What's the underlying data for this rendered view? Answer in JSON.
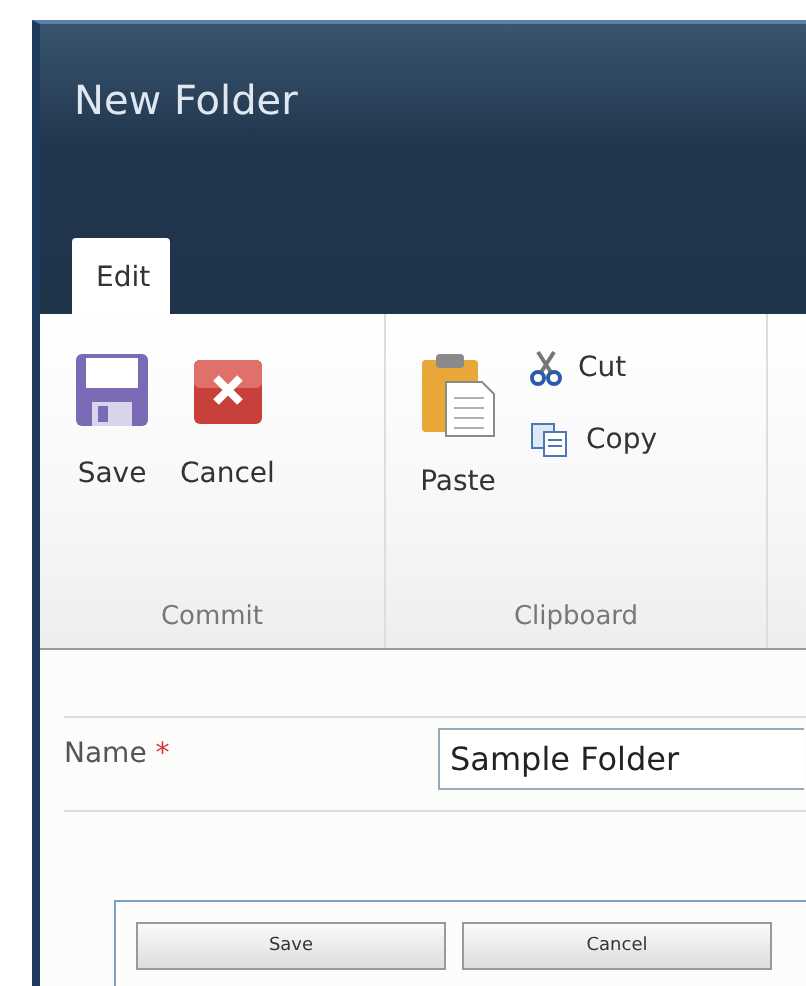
{
  "window": {
    "title": "New Folder"
  },
  "tabs": [
    {
      "label": "Edit",
      "selected": true
    }
  ],
  "ribbon_groups": [
    {
      "label": "Commit",
      "buttons": [
        {
          "label": "Save",
          "kind": "save"
        },
        {
          "label": "Cancel",
          "kind": "cancel"
        }
      ]
    },
    {
      "label": "Clipboard",
      "buttons": [
        {
          "label": "Paste",
          "kind": "paste"
        }
      ],
      "small_buttons": [
        {
          "label": "Cut",
          "kind": "cut"
        },
        {
          "label": "Copy",
          "kind": "copy"
        }
      ]
    }
  ],
  "fields": [
    {
      "label": "Name",
      "required_mark": "*",
      "value": "Sample Folder"
    }
  ],
  "footer_buttons": [
    "Save",
    "Cancel"
  ]
}
